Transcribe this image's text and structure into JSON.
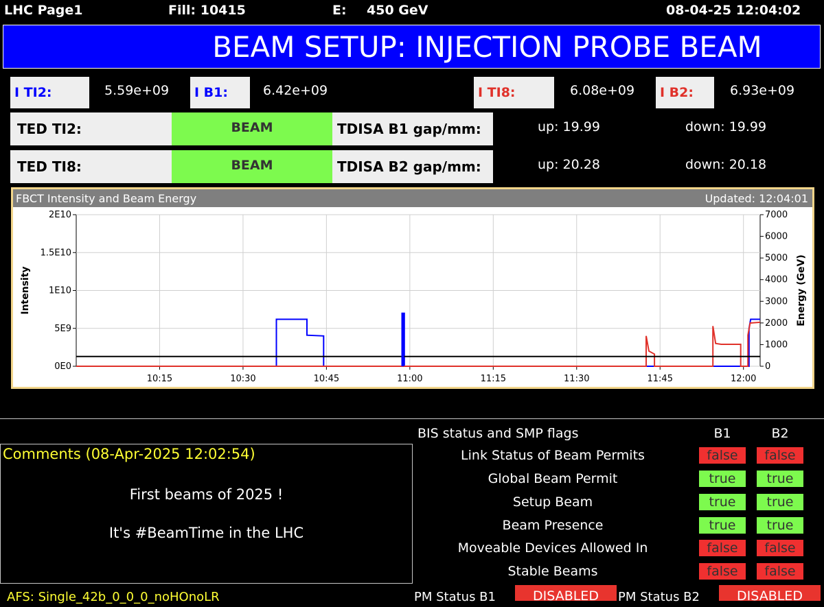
{
  "header": {
    "page": "LHC Page1",
    "fill": "Fill: 10415",
    "energy_label": "E:",
    "energy_value": "450 GeV",
    "datetime": "08-04-25 12:04:02"
  },
  "title": "BEAM SETUP: INJECTION PROBE BEAM",
  "intensities": {
    "ti2_label": "I TI2:",
    "ti2_value": "5.59e+09",
    "b1_label": "I B1:",
    "b1_value": "6.42e+09",
    "ti8_label": "I TI8:",
    "ti8_value": "6.08e+09",
    "b2_label": "I B2:",
    "b2_value": "6.93e+09"
  },
  "ted": {
    "ti2_label": "TED TI2:",
    "ti2_state": "BEAM",
    "ti8_label": "TED TI8:",
    "ti8_state": "BEAM"
  },
  "tdisa": {
    "b1_label": "TDISA B1 gap/mm:",
    "b1_up": "up:  19.99",
    "b1_down": "down:  19.99",
    "b2_label": "TDISA B2 gap/mm:",
    "b2_up": "up:  20.28",
    "b2_down": "down:  20.18"
  },
  "chart_header": {
    "title": "FBCT Intensity and Beam Energy",
    "updated": "Updated: 12:04:01"
  },
  "chart_data": {
    "type": "line",
    "ylabel": "Intensity",
    "y2label": "Energy (GeV)",
    "ylim": [
      0,
      20000000000
    ],
    "y2lim": [
      0,
      7000
    ],
    "xlim": [
      "10:00",
      "12:03"
    ],
    "xticks": [
      "10:15",
      "10:30",
      "10:45",
      "11:00",
      "11:15",
      "11:30",
      "11:45",
      "12:00"
    ],
    "yticks": [
      "0E0",
      "5E9",
      "1E10",
      "1.5E10",
      "2E10"
    ],
    "y2ticks": [
      "0",
      "1000",
      "2000",
      "3000",
      "4000",
      "5000",
      "6000",
      "7000"
    ],
    "grid": true,
    "series": [
      {
        "color": "#0000ff",
        "axis": "left",
        "points": [
          [
            "10:00",
            0
          ],
          [
            "10:36",
            0
          ],
          [
            "10:36",
            6200000000
          ],
          [
            "10:41.5",
            6200000000
          ],
          [
            "10:41.5",
            4100000000
          ],
          [
            "10:44.5",
            4000000000
          ],
          [
            "10:44.5",
            0
          ],
          [
            "10:58.6",
            0
          ],
          [
            "10:58.6",
            7000000000
          ],
          [
            "10:59.0",
            7000000000
          ],
          [
            "10:59.0",
            0
          ],
          [
            "12:01",
            0
          ],
          [
            "12:01",
            5000000000
          ],
          [
            "12:01.3",
            6200000000
          ],
          [
            "12:03",
            6200000000
          ]
        ]
      },
      {
        "color": "#e0312a",
        "axis": "left",
        "points": [
          [
            "10:00",
            0
          ],
          [
            "11:42.5",
            0
          ],
          [
            "11:42.5",
            4000000000
          ],
          [
            "11:43",
            2000000000
          ],
          [
            "11:44",
            1600000000
          ],
          [
            "11:44",
            0
          ],
          [
            "11:54.5",
            0
          ],
          [
            "11:54.5",
            5300000000
          ],
          [
            "11:55",
            3000000000
          ],
          [
            "11:56",
            2900000000
          ],
          [
            "11:59.5",
            2900000000
          ],
          [
            "11:59.5",
            0
          ],
          [
            "12:00.8",
            0
          ],
          [
            "12:00.8",
            4100000000
          ],
          [
            "12:01.2",
            5700000000
          ],
          [
            "12:03",
            5800000000
          ]
        ]
      },
      {
        "color": "#000000",
        "axis": "right",
        "points": [
          [
            "10:00",
            450
          ],
          [
            "12:03",
            450
          ]
        ]
      }
    ]
  },
  "comments": {
    "title": "Comments (08-Apr-2025 12:02:54)",
    "line1": "First beams of 2025 !",
    "line2": "It's #BeamTime in the LHC"
  },
  "bis": {
    "title": "BIS status and SMP flags",
    "b1": "B1",
    "b2": "B2",
    "rows": [
      {
        "label": "Link Status of Beam Permits",
        "b1": "false",
        "b2": "false"
      },
      {
        "label": "Global Beam Permit",
        "b1": "true",
        "b2": "true"
      },
      {
        "label": "Setup Beam",
        "b1": "true",
        "b2": "true"
      },
      {
        "label": "Beam Presence",
        "b1": "true",
        "b2": "true"
      },
      {
        "label": "Moveable Devices Allowed In",
        "b1": "false",
        "b2": "false"
      },
      {
        "label": "Stable Beams",
        "b1": "false",
        "b2": "false"
      }
    ]
  },
  "footer": {
    "afs": "AFS: Single_42b_0_0_0_noHOnoLR",
    "pm_b1_label": "PM Status B1",
    "pm_b1": "DISABLED",
    "pm_b2_label": "PM Status B2",
    "pm_b2": "DISABLED"
  },
  "colors": {
    "title_bg": "#0000ff",
    "true_flag": "#7dfa4e",
    "false_flag": "#f03030",
    "comments_text": "#ffff33"
  }
}
